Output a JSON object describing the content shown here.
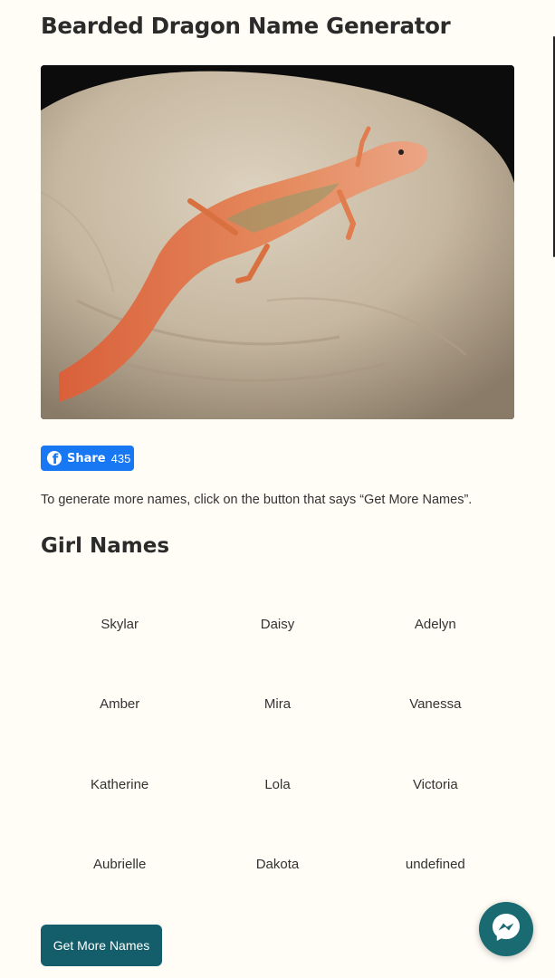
{
  "page": {
    "title": "Bearded Dragon Name Generator",
    "instructions": "To generate more names, click on the button that says “Get More Names”."
  },
  "share": {
    "label": "Share",
    "count": "435"
  },
  "girl_names": {
    "heading": "Girl Names",
    "names": [
      "Skylar",
      "Daisy",
      "Adelyn",
      "Amber",
      "Mira",
      "Vanessa",
      "Katherine",
      "Lola",
      "Victoria",
      "Aubrielle",
      "Dakota",
      "undefined"
    ]
  },
  "actions": {
    "more_label": "Get More Names"
  },
  "icons": {
    "share_logo": "facebook-f-icon",
    "chat": "messenger-icon"
  },
  "colors": {
    "background": "#fffdf6",
    "facebook_blue": "#1877f2",
    "button_teal": "#135e6a",
    "messenger_bg": "#1a6a72"
  }
}
